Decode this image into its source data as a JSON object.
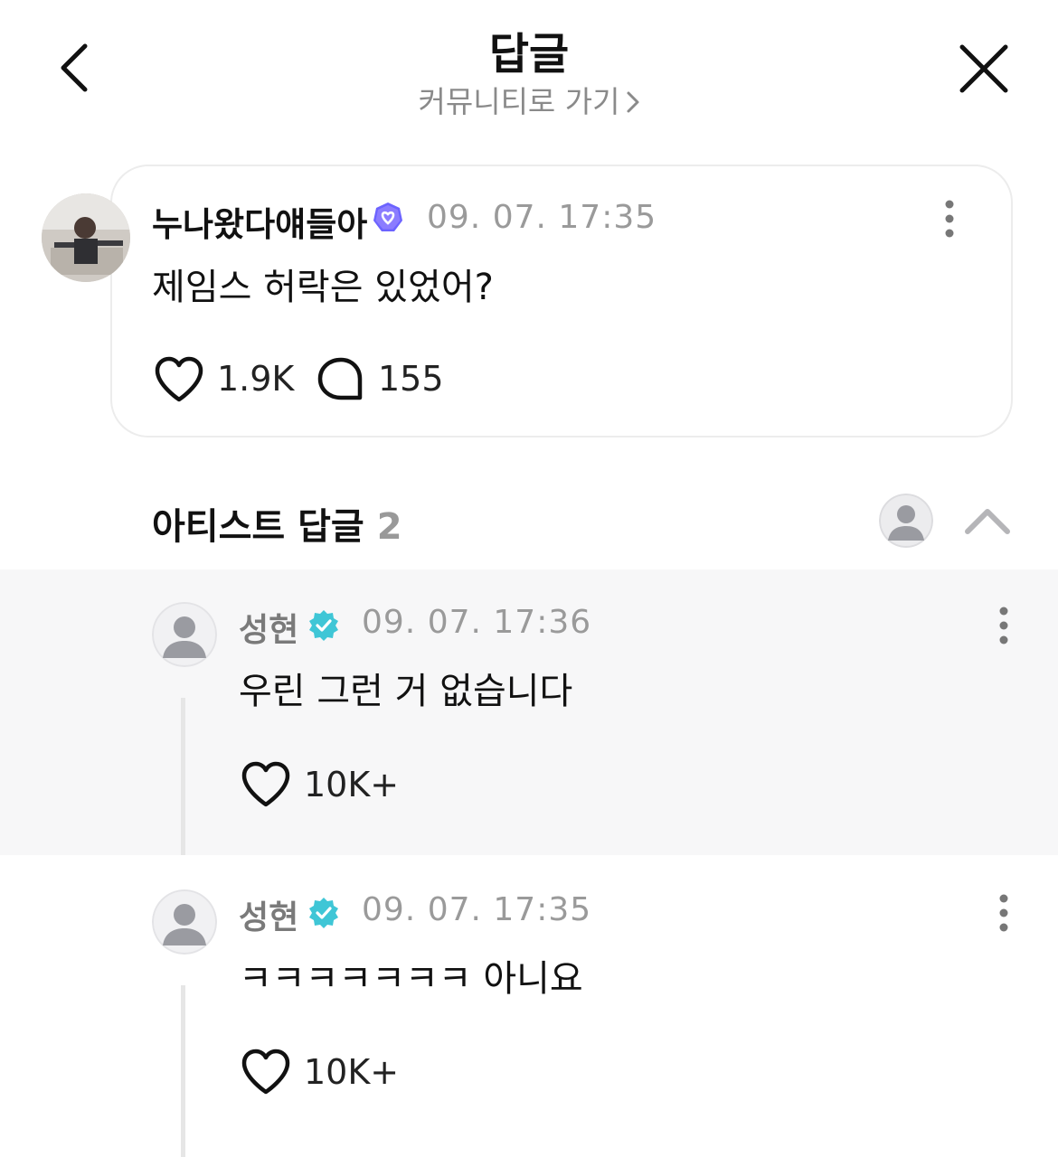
{
  "header": {
    "title": "답글",
    "subtitle": "커뮤니티로 가기"
  },
  "post": {
    "author": "누나왔다얘들아",
    "time": "09. 07. 17:35",
    "text": "제임스 허락은 있었어?",
    "likes": "1.9K",
    "comments": "155"
  },
  "artist_replies": {
    "title": "아티스트 답글",
    "count": "2",
    "items": [
      {
        "author": "성현",
        "time": "09. 07. 17:36",
        "text": "우린 그런 거 없습니다",
        "likes": "10K+"
      },
      {
        "author": "성현",
        "time": "09. 07. 17:35",
        "text": "ㅋㅋㅋㅋㅋㅋㅋ 아니요",
        "likes": "10K+"
      }
    ]
  },
  "colors": {
    "post_badge": "#6c63ff",
    "artist_badge": "#3fc6d6",
    "reply_highlight": "#f7f7f8"
  },
  "icons": {
    "back": "chevron-left-icon",
    "close": "close-icon",
    "like": "heart-outline-icon",
    "comment": "speech-bubble-icon",
    "more": "more-vertical-icon",
    "collapse": "chevron-up-icon"
  }
}
